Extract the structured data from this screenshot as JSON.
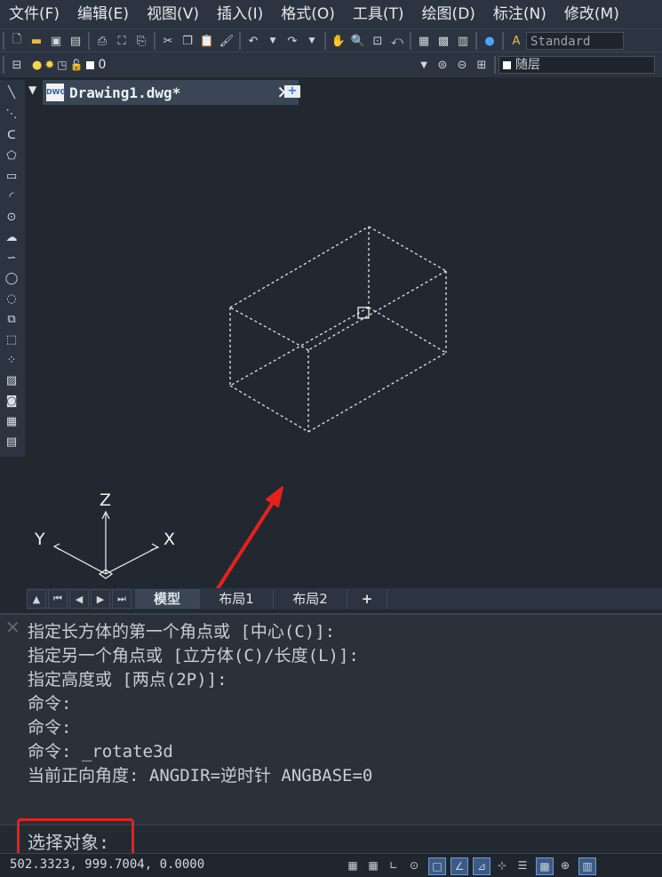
{
  "menu": [
    "文件(F)",
    "编辑(E)",
    "视图(V)",
    "插入(I)",
    "格式(O)",
    "工具(T)",
    "绘图(D)",
    "标注(N)",
    "修改(M)"
  ],
  "toolbar": {
    "text_style_value": "Standard",
    "layer_value": "0",
    "color_value": "随层"
  },
  "document_tab": {
    "title": "Drawing1.dwg*"
  },
  "ucs": {
    "z_label": "Z",
    "y_label": "Y",
    "x_label": "X"
  },
  "layout_tabs": [
    "模型",
    "布局1",
    "布局2",
    "+"
  ],
  "command_history": [
    "指定长方体的第一个角点或 [中心(C)]:",
    "指定另一个角点或 [立方体(C)/长度(L)]:",
    "指定高度或 [两点(2P)]:",
    "命令:",
    "命令:",
    "命令: _rotate3d",
    "当前正向角度:  ANGDIR=逆时针  ANGBASE=0"
  ],
  "command_prompt": "选择对象:",
  "status": {
    "coordinates": "502.3323, 999.7004, 0.0000"
  },
  "colors": {
    "annotation_red": "#e8201c",
    "canvas_bg": "#212830",
    "active_tab": "#3a4656"
  },
  "icons": {
    "left_toolbar": [
      "line-icon",
      "construction-line-icon",
      "polyline-icon",
      "polygon-icon",
      "rectangle-icon",
      "arc-icon",
      "circle-icon",
      "revision-cloud-icon",
      "spline-icon",
      "ellipse-icon",
      "ellipse-arc-icon",
      "insert-block-icon",
      "make-block-icon",
      "point-icon",
      "hatch-icon",
      "region-icon",
      "table-icon",
      "mtext-icon"
    ]
  }
}
